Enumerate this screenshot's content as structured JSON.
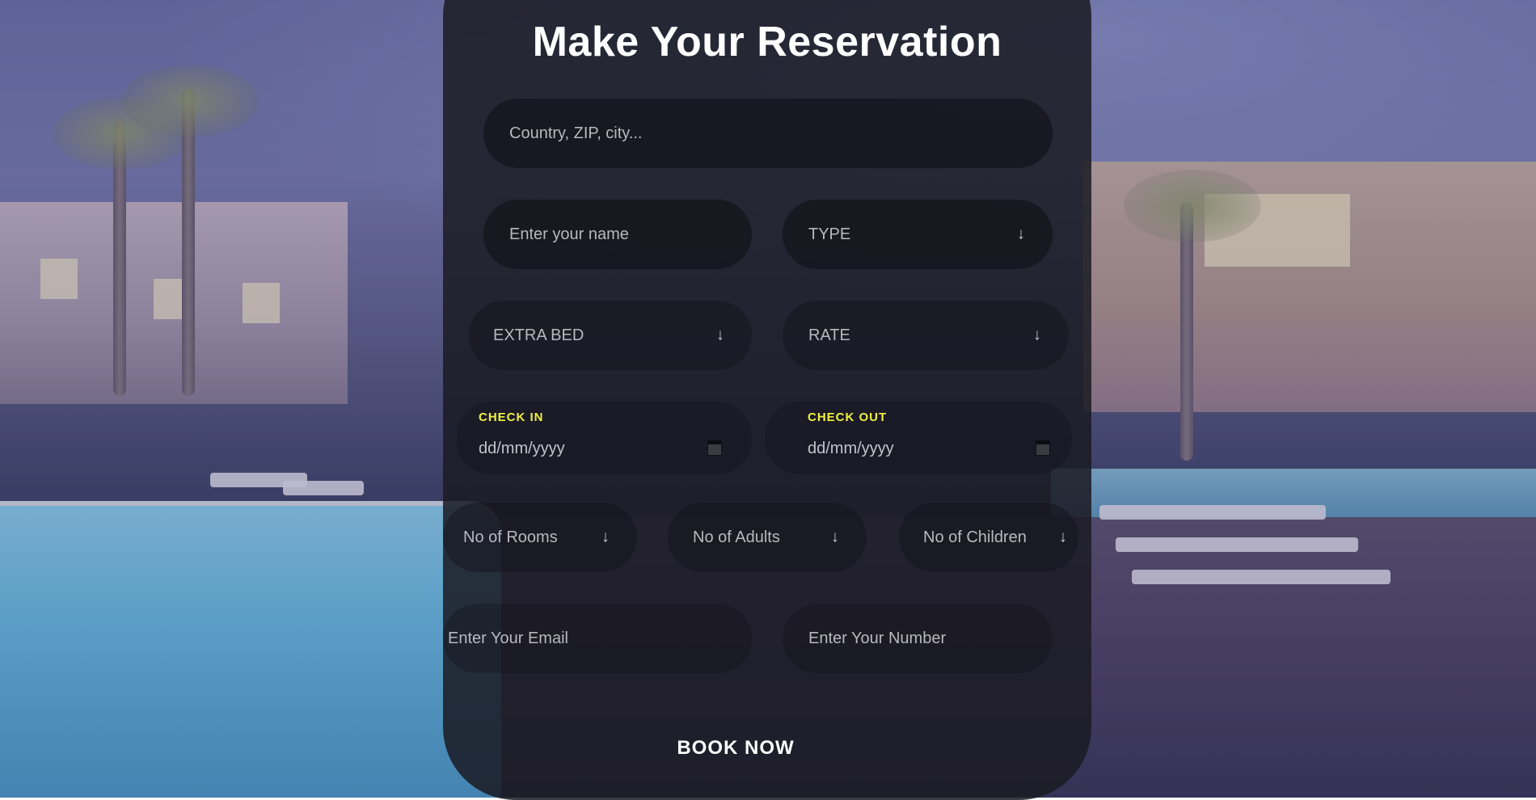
{
  "form": {
    "title": "Make Your Reservation",
    "location_placeholder": "Country, ZIP, city...",
    "name_placeholder": "Enter your name",
    "type_label": "TYPE",
    "extra_bed_label": "EXTRA BED",
    "rate_label": "RATE",
    "check_in_label": "CHECK IN",
    "check_in_placeholder": "dd/mm/yyyy",
    "check_out_label": "CHECK OUT",
    "check_out_placeholder": "dd/mm/yyyy",
    "rooms_label": "No of Rooms",
    "adults_label": "No of Adults",
    "children_label": "No of Children",
    "email_placeholder": "Enter Your Email",
    "number_placeholder": "Enter Your Number",
    "book_label": "BOOK NOW",
    "arrow_glyph": "↓"
  },
  "colors": {
    "accent_label": "#f0f040",
    "card_bg": "#1b1b23",
    "text": "#ffffff"
  },
  "icons": {
    "dropdown": "arrow-down-icon",
    "calendar": "calendar-icon"
  }
}
